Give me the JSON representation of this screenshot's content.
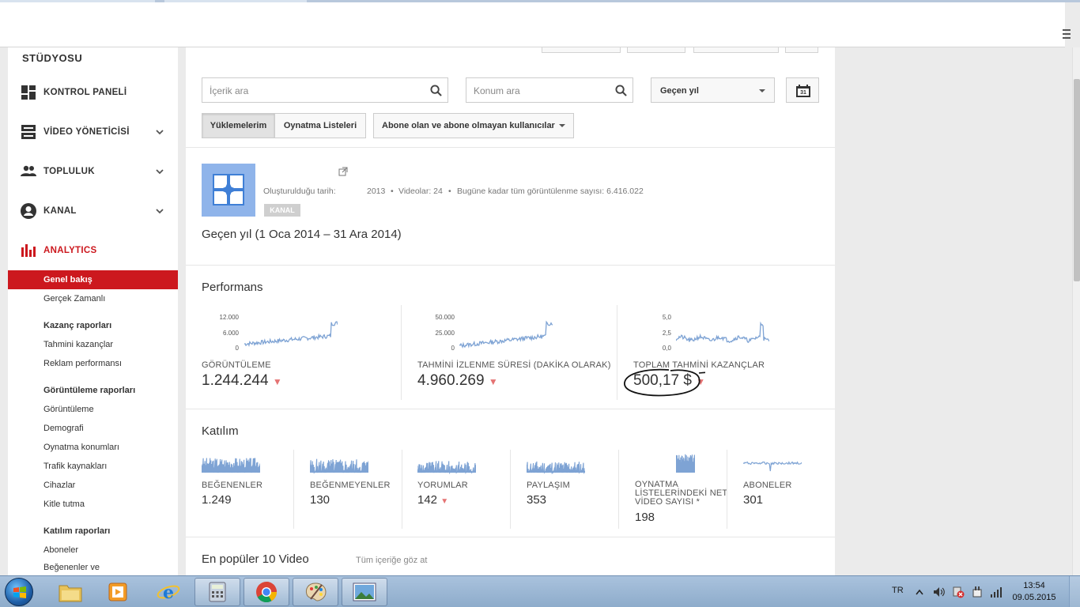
{
  "sidebar": {
    "studio_label": "STÜDYOSU",
    "nav": [
      {
        "label": "KONTROL PANELİ"
      },
      {
        "label": "VİDEO YÖNETİCİSİ"
      },
      {
        "label": "TOPLULUK"
      },
      {
        "label": "KANAL"
      },
      {
        "label": "ANALYTICS"
      }
    ],
    "analytics_items": {
      "overview": "Genel bakış",
      "realtime": "Gerçek Zamanlı",
      "earnings_head": "Kazanç raporları",
      "est_earnings": "Tahmini kazançlar",
      "ad_perf": "Reklam performansı",
      "views_head": "Görüntüleme raporları",
      "views": "Görüntüleme",
      "demographics": "Demografi",
      "playback_locations": "Oynatma konumları",
      "traffic_sources": "Trafik kaynakları",
      "devices": "Cihazlar",
      "audience_retention": "Kitle tutma",
      "engagement_head": "Katılım raporları",
      "subscribers": "Aboneler",
      "likes_dislikes": "Beğenenler ve"
    }
  },
  "filters": {
    "content_search_placeholder": "İçerik ara",
    "location_search_placeholder": "Konum ara",
    "date_range": "Geçen yıl",
    "calendar_day": "31",
    "tabs": [
      "Yüklemelerim",
      "Oynatma Listeleri"
    ],
    "subscriber_filter": "Abone olan ve abone olmayan kullanıcılar"
  },
  "channel": {
    "created_label": "Oluşturulduğu tarih:",
    "created_year": "2013",
    "videos": "Videolar: 24",
    "total_views": "Bugüne kadar tüm görüntülenme sayısı: 6.416.022",
    "badge": "KANAL",
    "period": "Geçen yıl (1 Oca 2014 – 31 Ara 2014)"
  },
  "performance": {
    "title": "Performans",
    "metrics": [
      {
        "label": "GÖRÜNTÜLEME",
        "value": "1.244.244",
        "trend": "down",
        "axis": [
          "12.000",
          "6.000",
          "0"
        ]
      },
      {
        "label": "TAHMİNİ İZLENME SÜRESİ (DAKİKA OLARAK)",
        "value": "4.960.269",
        "trend": "down",
        "axis": [
          "50.000",
          "25.000",
          "0"
        ]
      },
      {
        "label": "TOPLAM TAHMİNİ KAZANÇLAR",
        "value": "500,17 $",
        "trend": "down",
        "axis": [
          "5,0",
          "2,5",
          "0,0"
        ]
      }
    ]
  },
  "engagement": {
    "title": "Katılım",
    "metrics": [
      {
        "label": "BEĞENENLER",
        "value": "1.249"
      },
      {
        "label": "BEĞENMEYENLER",
        "value": "130"
      },
      {
        "label": "YORUMLAR",
        "value": "142",
        "trend": "down"
      },
      {
        "label": "PAYLAŞIM",
        "value": "353"
      },
      {
        "label": "OYNATMA LİSTELERİNDEKİ NET VİDEO SAYISI *",
        "value": "198"
      },
      {
        "label": "ABONELER",
        "value": "301"
      }
    ]
  },
  "top_videos": {
    "title": "En popüler 10 Video",
    "link": "Tüm içeriğe göz at"
  },
  "taskbar": {
    "lang": "TR",
    "time": "13:54",
    "date": "09.05.2015"
  },
  "colors": {
    "accent_red": "#cc181e",
    "spark_blue": "#7ea3d4",
    "trend_red": "#e57373"
  }
}
